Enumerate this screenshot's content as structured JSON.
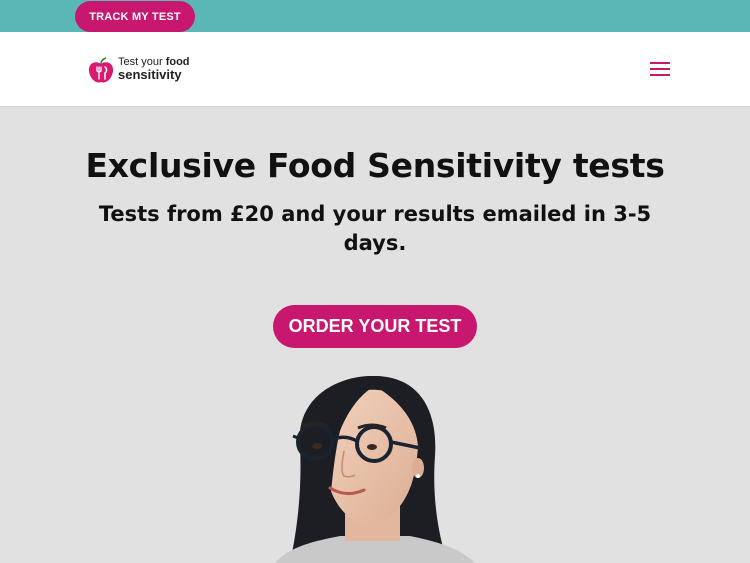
{
  "topbar": {
    "track_label": "TRACK MY TEST"
  },
  "header": {
    "logo": {
      "line1_a": "Test your ",
      "line1_b": "food",
      "line2": "sensitivity"
    },
    "menu_icon": "hamburger-menu-icon"
  },
  "hero": {
    "title": "Exclusive Food Sensitivity tests",
    "subtitle": "Tests from £20 and your results emailed in 3-5 days.",
    "cta_label": "ORDER YOUR TEST"
  },
  "colors": {
    "accent": "#c8176f",
    "topbar": "#5bb6b6",
    "hero_bg": "#e1e1e1"
  }
}
